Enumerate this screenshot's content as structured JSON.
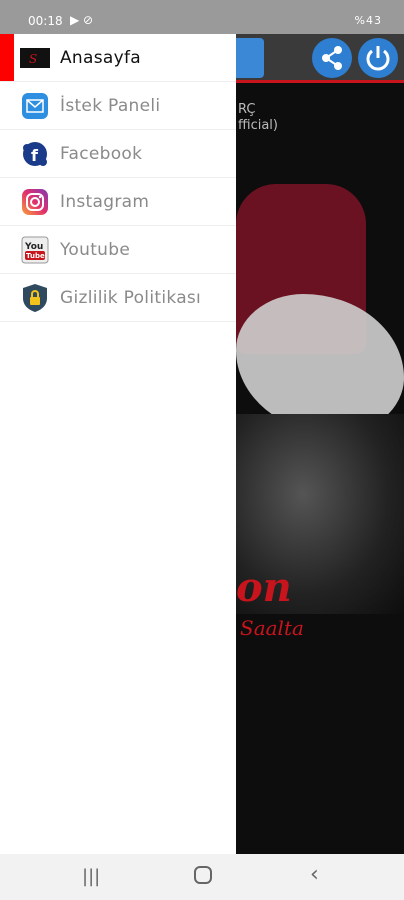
{
  "status": {
    "time": "00:18",
    "right": "%43"
  },
  "background": {
    "line1": "RÇ",
    "line2": "fficial)"
  },
  "drawer": {
    "items": [
      {
        "label": "Anasayfa",
        "icon": "app-logo-icon",
        "active": true
      },
      {
        "label": "İstek Paneli",
        "icon": "mail-icon",
        "active": false
      },
      {
        "label": "Facebook",
        "icon": "facebook-icon",
        "active": false
      },
      {
        "label": "Instagram",
        "icon": "instagram-icon",
        "active": false
      },
      {
        "label": "Youtube",
        "icon": "youtube-icon",
        "active": false
      },
      {
        "label": "Gizlilik Politikası",
        "icon": "shield-lock-icon",
        "active": false
      }
    ]
  },
  "colors": {
    "accent": "#ff0000",
    "header_button": "#2e7fd1"
  }
}
